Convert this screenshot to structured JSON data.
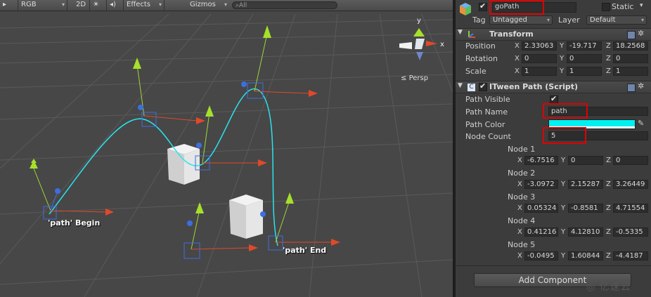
{
  "scene_toolbar": {
    "draw_mode": "RGB",
    "mode_2d": "2D",
    "light_icon": "sun-icon",
    "audio_icon": "speaker-icon",
    "effects_label": "Effects",
    "gizmos_label": "Gizmos",
    "search_placeholder": "All"
  },
  "scene": {
    "path_begin_label": "'path' Begin",
    "path_end_label": "'path' End",
    "persp_label": "Persp",
    "path_color": "#29e3ee"
  },
  "inspector": {
    "object_name": "goPath",
    "active_checked": true,
    "static_label": "Static",
    "tag_label": "Tag",
    "tag_value": "Untagged",
    "layer_label": "Layer",
    "layer_value": "Default",
    "transform": {
      "title": "Transform",
      "position_label": "Position",
      "position": {
        "x": "2.33063",
        "y": "-19.717",
        "z": "18.2568"
      },
      "rotation_label": "Rotation",
      "rotation": {
        "x": "0",
        "y": "0",
        "z": "0"
      },
      "scale_label": "Scale",
      "scale": {
        "x": "1",
        "y": "1",
        "z": "1"
      }
    },
    "itween": {
      "title": "ITween Path (Script)",
      "path_visible_label": "Path Visible",
      "path_visible_checked": true,
      "path_name_label": "Path Name",
      "path_name_value": "path",
      "path_color_label": "Path Color",
      "path_color_value": "#00f0f0",
      "node_count_label": "Node Count",
      "node_count_value": "5",
      "nodes": [
        {
          "label": "Node 1",
          "x": "-6.7516",
          "y": "0",
          "z": "0"
        },
        {
          "label": "Node 2",
          "x": "-3.0972",
          "y": "2.15287",
          "z": "3.26449"
        },
        {
          "label": "Node 3",
          "x": "0.05324",
          "y": "-0.8581",
          "z": "4.71554"
        },
        {
          "label": "Node 4",
          "x": "0.41216",
          "y": "4.12810",
          "z": "-0.5335"
        },
        {
          "label": "Node 5",
          "x": "-0.0495",
          "y": "1.60844",
          "z": "-4.4187"
        }
      ]
    },
    "add_component_label": "Add Component",
    "watermark": "亿速云"
  }
}
